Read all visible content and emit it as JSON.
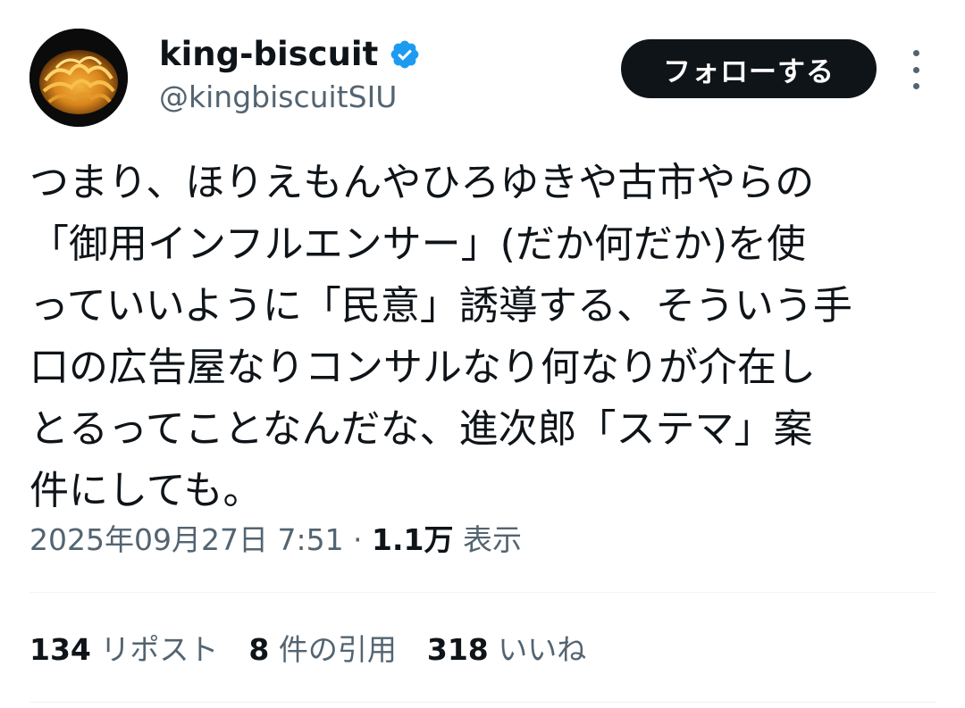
{
  "author": {
    "display_name": "king-biscuit",
    "handle": "@kingbiscuitSIU",
    "verified_icon": "verified-badge-icon",
    "verified_color": "#1d9bf0"
  },
  "follow_button": {
    "label": "フォローする"
  },
  "more_menu": {
    "icon": "more-vertical-icon"
  },
  "tweet": {
    "lines": [
      "つまり、ほりえもんやひろゆきや古市やらの",
      "「御用インフルエンサー」(だか何だか)を使",
      "っていいように「民意」誘導する、そういう手",
      "口の広告屋なりコンサルなり何なりが介在し",
      "とるってことなんだな、進次郎「ステマ」案",
      "件にしても。"
    ]
  },
  "meta": {
    "timestamp": "2025年09月27日 7:51",
    "separator": " · ",
    "views_count": "1.1万",
    "views_label": " 表示"
  },
  "stats": {
    "reposts_count": "134",
    "reposts_label": " リポスト",
    "quotes_count": "8",
    "quotes_label": " 件の引用",
    "likes_count": "318",
    "likes_label": " いいね"
  },
  "colors": {
    "text_primary": "#0f1419",
    "text_secondary": "#536471",
    "follow_bg": "#0f1419",
    "divider": "#eff3f4"
  }
}
